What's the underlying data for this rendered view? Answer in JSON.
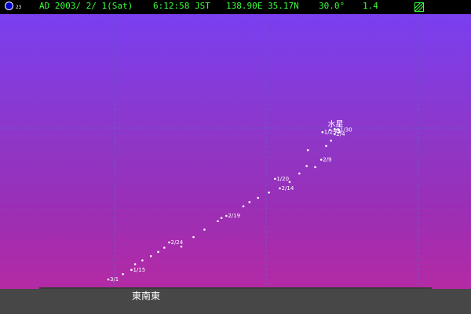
{
  "status_bar": {
    "moon_age": "23",
    "date": "AD 2003/ 2/ 1(Sat)",
    "time": "6:12:58 JST",
    "location": "138.90E 35.17N",
    "field_of_view": "30.0°",
    "magnitude": "1.4",
    "text_color": "#3bff3b",
    "moon_icon": "moon-phase-icon",
    "menu_icon": "hatched-box-icon"
  },
  "sky": {
    "direction_label": "東南東",
    "planet_label": "水星",
    "sky_colors": [
      "#7a3ff0",
      "#b42aa4"
    ],
    "ground_color": "#474747"
  },
  "chart_data": {
    "type": "scatter",
    "title": "",
    "xlabel": "",
    "ylabel": "",
    "series": [
      {
        "points": [
          {
            "x": 0.0,
            "y": 0.0,
            "label": "3/1"
          },
          {
            "x": 0.6,
            "y": 0.25,
            "label": ""
          },
          {
            "x": 0.95,
            "y": 0.45,
            "label": "1/15"
          },
          {
            "x": 1.1,
            "y": 0.72,
            "label": ""
          },
          {
            "x": 1.4,
            "y": 0.9,
            "label": ""
          },
          {
            "x": 1.75,
            "y": 1.1,
            "label": ""
          },
          {
            "x": 2.05,
            "y": 1.3,
            "label": ""
          },
          {
            "x": 2.3,
            "y": 1.5,
            "label": ""
          },
          {
            "x": 2.5,
            "y": 1.75,
            "label": "2/24"
          },
          {
            "x": 3.0,
            "y": 1.55,
            "label": ""
          },
          {
            "x": 3.5,
            "y": 2.0,
            "label": ""
          },
          {
            "x": 3.95,
            "y": 2.35,
            "label": ""
          },
          {
            "x": 4.5,
            "y": 2.75,
            "label": ""
          },
          {
            "x": 4.65,
            "y": 2.9,
            "label": ""
          },
          {
            "x": 4.85,
            "y": 3.0,
            "label": "2/19"
          },
          {
            "x": 5.55,
            "y": 3.45,
            "label": ""
          },
          {
            "x": 5.8,
            "y": 3.65,
            "label": ""
          },
          {
            "x": 6.15,
            "y": 3.85,
            "label": ""
          },
          {
            "x": 6.6,
            "y": 4.1,
            "label": ""
          },
          {
            "x": 7.05,
            "y": 4.3,
            "label": "2/14"
          },
          {
            "x": 6.85,
            "y": 4.75,
            "label": "1/20"
          },
          {
            "x": 7.45,
            "y": 4.6,
            "label": ""
          },
          {
            "x": 7.85,
            "y": 5.0,
            "label": ""
          },
          {
            "x": 8.15,
            "y": 5.35,
            "label": ""
          },
          {
            "x": 8.5,
            "y": 5.3,
            "label": ""
          },
          {
            "x": 8.75,
            "y": 5.65,
            "label": "2/9"
          },
          {
            "x": 8.2,
            "y": 6.1,
            "label": ""
          },
          {
            "x": 8.95,
            "y": 6.3,
            "label": ""
          },
          {
            "x": 9.15,
            "y": 6.55,
            "label": ""
          },
          {
            "x": 9.3,
            "y": 6.85,
            "label": "2/4"
          },
          {
            "x": 8.8,
            "y": 6.95,
            "label": "1/25"
          },
          {
            "x": 9.1,
            "y": 7.05,
            "label": ""
          },
          {
            "x": 9.3,
            "y": 7.1,
            "label": ""
          },
          {
            "x": 9.45,
            "y": 7.05,
            "label": "1/30"
          },
          {
            "x": 9.5,
            "y": 6.95,
            "label": ""
          }
        ]
      }
    ]
  }
}
